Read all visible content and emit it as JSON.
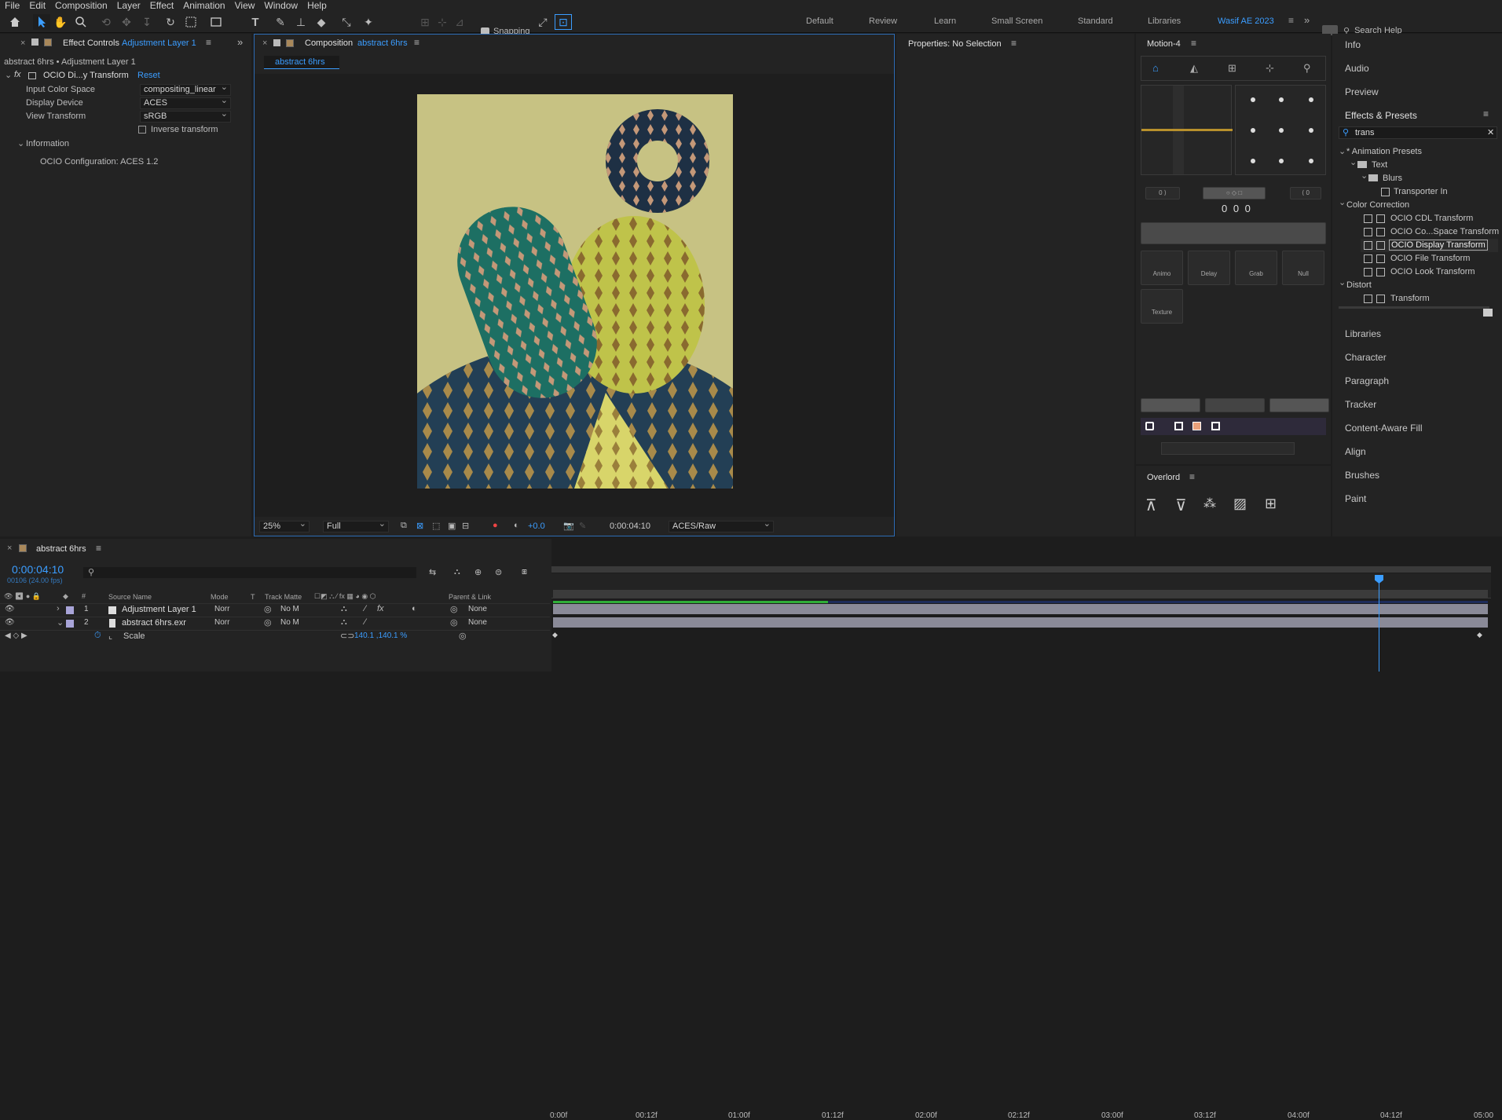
{
  "menu": [
    "File",
    "Edit",
    "Composition",
    "Layer",
    "Effect",
    "Animation",
    "View",
    "Window",
    "Help"
  ],
  "toolbar": {
    "snapping_label": "Snapping",
    "workspaces": [
      "Default",
      "Review",
      "Learn",
      "Small Screen",
      "Standard",
      "Libraries"
    ],
    "active_workspace": "Wasif AE 2023",
    "search_placeholder": "Search Help"
  },
  "effect_controls": {
    "tab_title": "Effect Controls",
    "tab_layer": "Adjustment Layer 1",
    "breadcrumb": "abstract 6hrs • Adjustment Layer 1",
    "effect_name": "OCIO Di...y Transform",
    "reset_label": "Reset",
    "props": [
      {
        "label": "Input Color Space",
        "value": "compositing_linear"
      },
      {
        "label": "Display Device",
        "value": "ACES"
      },
      {
        "label": "View Transform",
        "value": "sRGB"
      }
    ],
    "inverse_label": "Inverse transform",
    "info_group": "Information",
    "info_text": "OCIO Configuration: ACES 1.2"
  },
  "composition": {
    "tab_title": "Composition",
    "tab_comp": "abstract 6hrs",
    "subtab": "abstract 6hrs",
    "zoom": "25%",
    "resolution": "Full",
    "exposure": "+0.0",
    "timecode": "0:00:04:10",
    "view": "ACES/Raw"
  },
  "properties": {
    "title": "Properties: No Selection"
  },
  "motion4": {
    "title": "Motion-4",
    "counter_left": "0",
    "counter_right": "0",
    "values": "0 0 0",
    "tools": [
      "Animo",
      "Delay",
      "Grab",
      "Null",
      "Texture"
    ]
  },
  "overlord": {
    "title": "Overlord"
  },
  "right_sidebar": {
    "top_items": [
      "Info",
      "Audio",
      "Preview"
    ],
    "effects_presets_title": "Effects & Presets",
    "search_value": "trans",
    "tree": [
      {
        "label": "* Animation Presets",
        "level": 0,
        "type": "folder"
      },
      {
        "label": "Text",
        "level": 1,
        "type": "folder"
      },
      {
        "label": "Blurs",
        "level": 2,
        "type": "folder"
      },
      {
        "label": "Transporter In",
        "level": 3,
        "type": "preset"
      },
      {
        "label": "Color Correction",
        "level": 0,
        "type": "folder"
      },
      {
        "label": "OCIO CDL Transform",
        "level": 1,
        "type": "effect"
      },
      {
        "label": "OCIO Co...Space Transform",
        "level": 1,
        "type": "effect"
      },
      {
        "label": "OCIO Display Transform",
        "level": 1,
        "type": "effect",
        "selected": true
      },
      {
        "label": "OCIO File Transform",
        "level": 1,
        "type": "effect"
      },
      {
        "label": "OCIO Look Transform",
        "level": 1,
        "type": "effect"
      },
      {
        "label": "Distort",
        "level": 0,
        "type": "folder"
      },
      {
        "label": "Transform",
        "level": 1,
        "type": "effect"
      }
    ],
    "bottom_items": [
      "Libraries",
      "Character",
      "Paragraph",
      "Tracker",
      "Content-Aware Fill",
      "Align",
      "Brushes",
      "Paint"
    ]
  },
  "timeline": {
    "tab_title": "abstract 6hrs",
    "timecode": "0:00:04:10",
    "frame_info": "00106 (24.00 fps)",
    "columns": [
      "Source Name",
      "Mode",
      "T",
      "Track Matte",
      "Parent & Link"
    ],
    "layers": [
      {
        "num": "1",
        "name": "Adjustment Layer 1",
        "mode": "Norr",
        "matte": "No M",
        "parent": "None"
      },
      {
        "num": "2",
        "name": "abstract 6hrs.exr",
        "mode": "Norr",
        "matte": "No M",
        "parent": "None"
      }
    ],
    "scale_label": "Scale",
    "scale_value": "140.1 ,140.1 %",
    "ruler_labels": [
      "0:00f",
      "00:12f",
      "01:00f",
      "01:12f",
      "02:00f",
      "02:12f",
      "03:00f",
      "03:12f",
      "04:00f",
      "04:12f",
      "05:00"
    ]
  }
}
